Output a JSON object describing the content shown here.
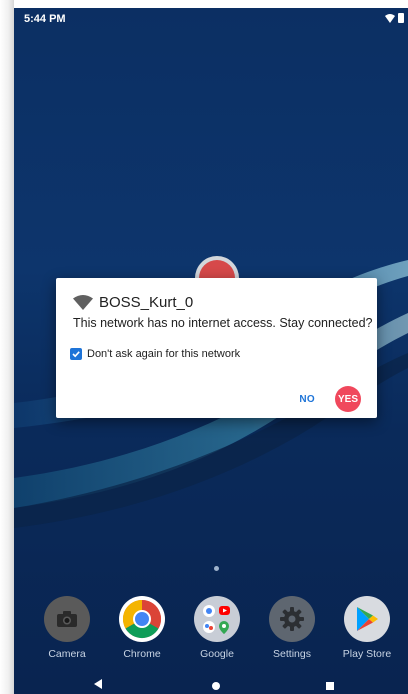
{
  "status_bar": {
    "time": "5:44 PM"
  },
  "dialog": {
    "title": "BOSS_Kurt_0",
    "message": "This network has no internet access. Stay connected?",
    "checkbox_label": "Don't ask again for this network",
    "checkbox_checked": true,
    "no_label": "NO",
    "yes_label": "YES"
  },
  "dock": {
    "apps": [
      {
        "label": "Camera",
        "icon": "camera-icon"
      },
      {
        "label": "Chrome",
        "icon": "chrome-icon"
      },
      {
        "label": "Google",
        "icon": "google-folder-icon"
      },
      {
        "label": "Settings",
        "icon": "gear-icon"
      },
      {
        "label": "Play Store",
        "icon": "play-store-icon"
      }
    ]
  },
  "navigation": {
    "buttons": [
      "back-icon",
      "home-icon",
      "recents-icon"
    ]
  },
  "colors": {
    "accent": "#1e74d8",
    "yes_button": "#f0485c",
    "wallpaper": "#0c2f63"
  }
}
